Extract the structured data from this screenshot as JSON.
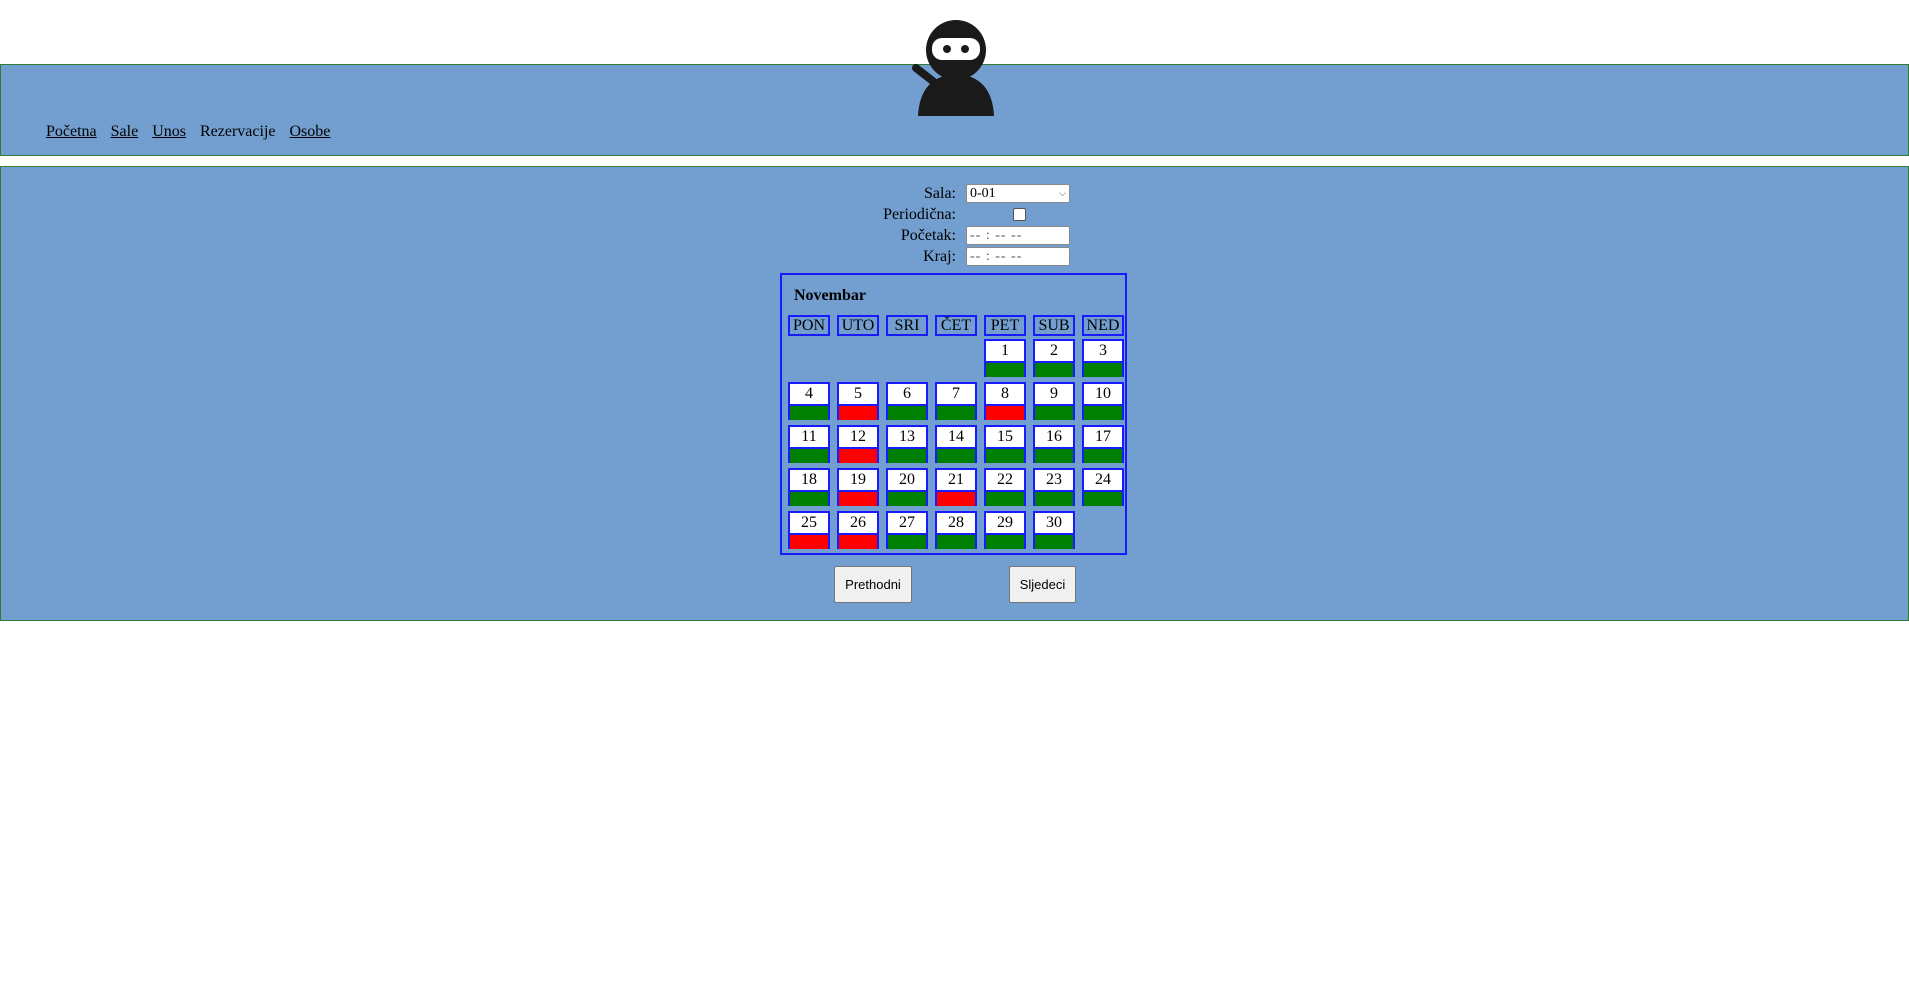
{
  "nav": {
    "items": [
      {
        "label": "Početna",
        "link": true
      },
      {
        "label": "Sale",
        "link": true
      },
      {
        "label": "Unos",
        "link": true
      },
      {
        "label": "Rezervacije",
        "link": false
      },
      {
        "label": "Osobe",
        "link": true
      }
    ]
  },
  "form": {
    "sala_label": "Sala:",
    "sala_value": "0-01",
    "periodicna_label": "Periodična:",
    "periodicna_checked": false,
    "pocetak_label": "Početak:",
    "pocetak_placeholder": "-- : --   --",
    "kraj_label": "Kraj:",
    "kraj_placeholder": "-- : --   --"
  },
  "calendar": {
    "month": "Novembar",
    "weekdays": [
      "PON",
      "UTO",
      "SRI",
      "ČET",
      "PET",
      "SUB",
      "NED"
    ],
    "first_weekday_index": 4,
    "days": [
      {
        "d": "1",
        "s": "free"
      },
      {
        "d": "2",
        "s": "free"
      },
      {
        "d": "3",
        "s": "free"
      },
      {
        "d": "4",
        "s": "free"
      },
      {
        "d": "5",
        "s": "busy"
      },
      {
        "d": "6",
        "s": "free"
      },
      {
        "d": "7",
        "s": "free"
      },
      {
        "d": "8",
        "s": "busy"
      },
      {
        "d": "9",
        "s": "free"
      },
      {
        "d": "10",
        "s": "free"
      },
      {
        "d": "11",
        "s": "free"
      },
      {
        "d": "12",
        "s": "busy"
      },
      {
        "d": "13",
        "s": "free"
      },
      {
        "d": "14",
        "s": "free"
      },
      {
        "d": "15",
        "s": "free"
      },
      {
        "d": "16",
        "s": "free"
      },
      {
        "d": "17",
        "s": "free"
      },
      {
        "d": "18",
        "s": "free"
      },
      {
        "d": "19",
        "s": "busy"
      },
      {
        "d": "20",
        "s": "free"
      },
      {
        "d": "21",
        "s": "busy"
      },
      {
        "d": "22",
        "s": "free"
      },
      {
        "d": "23",
        "s": "free"
      },
      {
        "d": "24",
        "s": "free"
      },
      {
        "d": "25",
        "s": "busy"
      },
      {
        "d": "26",
        "s": "busy"
      },
      {
        "d": "27",
        "s": "free"
      },
      {
        "d": "28",
        "s": "free"
      },
      {
        "d": "29",
        "s": "free"
      },
      {
        "d": "30",
        "s": "free"
      }
    ],
    "colors": {
      "free": "#008000",
      "busy": "#ff0000",
      "border": "#1a1aff"
    }
  },
  "buttons": {
    "prev_label": "Prethodni",
    "next_label": "Sljedeci"
  }
}
